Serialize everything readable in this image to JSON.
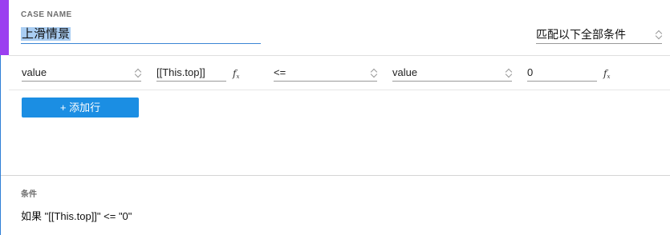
{
  "case": {
    "label": "CASE NAME",
    "name": "上滑情景"
  },
  "match_mode": {
    "selected": "匹配以下全部条件"
  },
  "condition_row": {
    "left_value_type": "value",
    "left_expression": "[[This.top]]",
    "operator": "<=",
    "right_value_type": "value",
    "right_expression": "0",
    "fx_icon": "fx"
  },
  "add_row_button": "+ 添加行",
  "summary": {
    "label": "条件",
    "text": "如果 \"[[This.top]]\" <= \"0\""
  },
  "colors": {
    "accent": "#9b3ff0",
    "button": "#1b8ee3",
    "selection": "#a9cdf2"
  }
}
